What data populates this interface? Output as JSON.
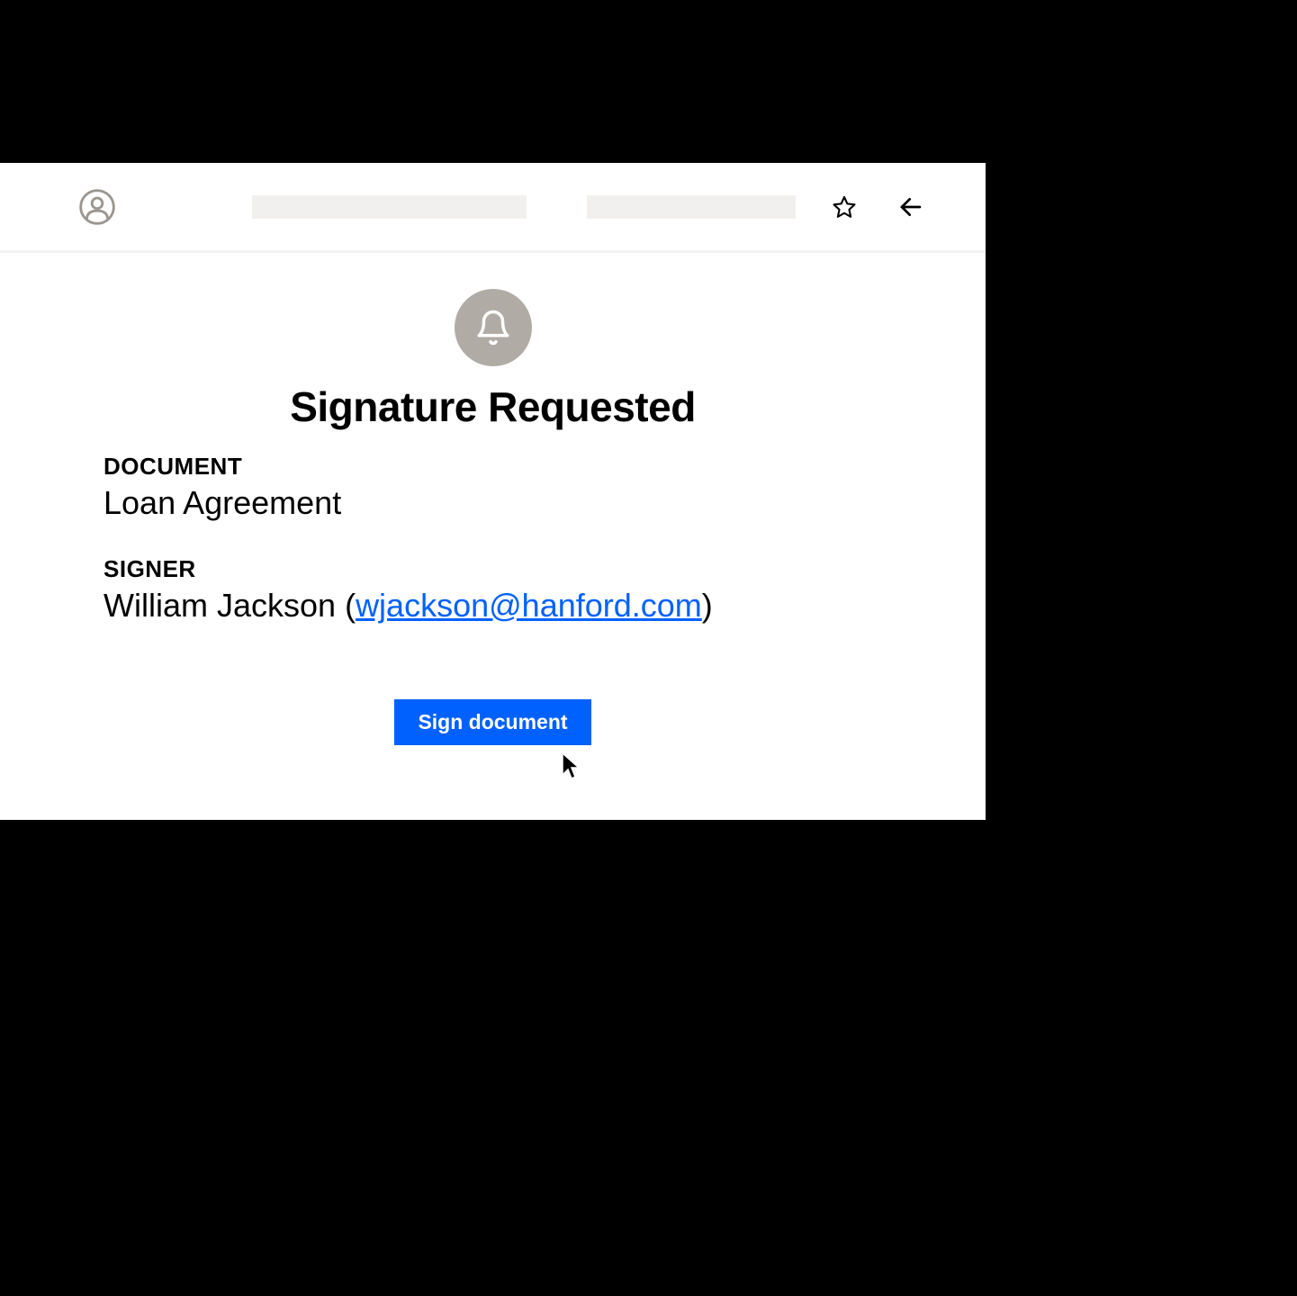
{
  "title": "Signature Requested",
  "document": {
    "label": "DOCUMENT",
    "value": "Loan Agreement"
  },
  "signer": {
    "label": "SIGNER",
    "name": "William Jackson",
    "email": "wjackson@hanford.com"
  },
  "button": {
    "sign_label": "Sign document"
  }
}
